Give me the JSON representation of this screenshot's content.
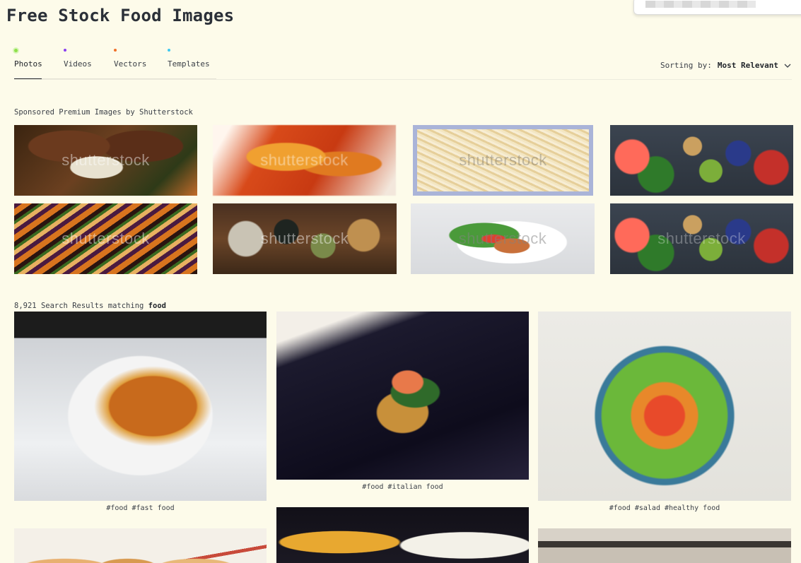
{
  "page": {
    "title": "Free Stock Food Images"
  },
  "tabs": [
    {
      "label": "Photos",
      "dot_color": "#8fe04a",
      "active": true
    },
    {
      "label": "Videos",
      "dot_color": "#8a3ff0"
    },
    {
      "label": "Vectors",
      "dot_color": "#f0702a"
    },
    {
      "label": "Templates",
      "dot_color": "#3fc8f0"
    }
  ],
  "sorting": {
    "prefix": "Sorting by:",
    "value": "Most Relevant",
    "icon": "chevron-down-icon"
  },
  "sponsored": {
    "label": "Sponsored Premium Images by Shutterstock",
    "watermark": "shutterstock"
  },
  "results": {
    "count": "8,921",
    "label_middle": "Search Results matching",
    "query": "food",
    "captions": [
      "#food #fast food",
      "#food #italian food",
      "#food #salad #healthy food"
    ]
  }
}
